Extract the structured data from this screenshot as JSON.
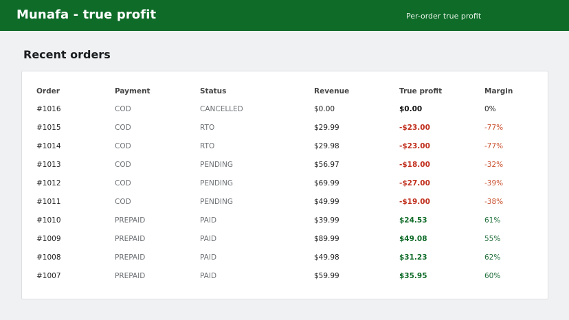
{
  "header": {
    "title": "Munafa - true profit",
    "subtitle": "Per-order true profit"
  },
  "section": {
    "title": "Recent orders"
  },
  "table": {
    "columns": [
      "Order",
      "Payment",
      "Status",
      "Revenue",
      "True profit",
      "Margin"
    ],
    "rows": [
      {
        "order": "#1016",
        "payment": "COD",
        "status": "CANCELLED",
        "revenue": "$0.00",
        "profit": "$0.00",
        "margin": "0%",
        "tone": "neutral"
      },
      {
        "order": "#1015",
        "payment": "COD",
        "status": "RTO",
        "revenue": "$29.99",
        "profit": "-$23.00",
        "margin": "-77%",
        "tone": "negative"
      },
      {
        "order": "#1014",
        "payment": "COD",
        "status": "RTO",
        "revenue": "$29.98",
        "profit": "-$23.00",
        "margin": "-77%",
        "tone": "negative"
      },
      {
        "order": "#1013",
        "payment": "COD",
        "status": "PENDING",
        "revenue": "$56.97",
        "profit": "-$18.00",
        "margin": "-32%",
        "tone": "negative"
      },
      {
        "order": "#1012",
        "payment": "COD",
        "status": "PENDING",
        "revenue": "$69.99",
        "profit": "-$27.00",
        "margin": "-39%",
        "tone": "negative"
      },
      {
        "order": "#1011",
        "payment": "COD",
        "status": "PENDING",
        "revenue": "$49.99",
        "profit": "-$19.00",
        "margin": "-38%",
        "tone": "negative"
      },
      {
        "order": "#1010",
        "payment": "PREPAID",
        "status": "PAID",
        "revenue": "$39.99",
        "profit": "$24.53",
        "margin": "61%",
        "tone": "positive"
      },
      {
        "order": "#1009",
        "payment": "PREPAID",
        "status": "PAID",
        "revenue": "$89.99",
        "profit": "$49.08",
        "margin": "55%",
        "tone": "positive"
      },
      {
        "order": "#1008",
        "payment": "PREPAID",
        "status": "PAID",
        "revenue": "$49.98",
        "profit": "$31.23",
        "margin": "62%",
        "tone": "positive"
      },
      {
        "order": "#1007",
        "payment": "PREPAID",
        "status": "PAID",
        "revenue": "$59.99",
        "profit": "$35.95",
        "margin": "60%",
        "tone": "positive"
      }
    ]
  },
  "colors": {
    "brand": "#0e6b28",
    "negative": "#c0301e",
    "positive": "#0e6b28"
  }
}
